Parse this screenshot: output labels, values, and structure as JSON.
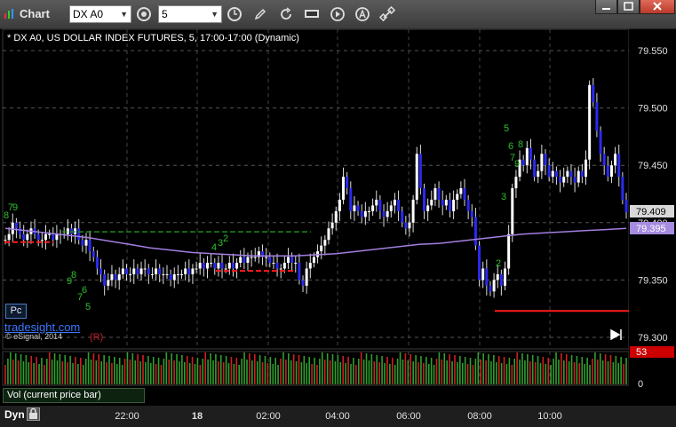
{
  "window": {
    "title": "Chart"
  },
  "toolbar": {
    "symbol": "DX A0",
    "interval": "5",
    "tool_icons": [
      "clock-icon",
      "pencil-icon",
      "refresh-icon",
      "template-icon",
      "play-icon",
      "text-icon",
      "link-icon"
    ]
  },
  "window_controls": [
    "minimize",
    "maximize",
    "close"
  ],
  "chart": {
    "legend": "* DX A0, US DOLLAR INDEX FUTURES, 5, 17:00-17:00 (Dynamic)",
    "price_axis_ticks": [
      "79.550",
      "79.500",
      "79.450",
      "79.400",
      "79.350",
      "79.300"
    ],
    "last_price_tag": "79.409",
    "ma_price_tag": "79.395",
    "time_labels": [
      "22:00",
      "18",
      "02:00",
      "04:00",
      "06:00",
      "08:00",
      "10:00"
    ],
    "pc_label": "Pc",
    "watermark": "tradesight.com",
    "copyright": "© eSignal, 2014",
    "r_marker": "(R)",
    "setup_numbers": [
      "8",
      "7",
      "9",
      "5",
      "6",
      "7",
      "8",
      "9",
      "3",
      "2",
      "9",
      "8",
      "7",
      "6",
      "5",
      "4",
      "3",
      "2"
    ]
  },
  "volume_pane": {
    "title": "Vol (current price bar)",
    "tag": "53",
    "zero_label": "0"
  },
  "status": {
    "mode": "Dyn"
  },
  "colors": {
    "up_candle": "#ffffff",
    "down_candle": "#2a2af0",
    "moving_average": "#a27fe0",
    "setup_numbers": "#2fbf2f",
    "resistance_green": "#1b8a1b",
    "support_red": "#ff1a1a",
    "last_tag_bg": "#d8d8d8",
    "ma_tag_bg": "#a68ce0",
    "vol_up": "#2f9f2f",
    "vol_down": "#d02020",
    "vol_tag_bg": "#cc0000"
  },
  "chart_data": {
    "type": "candlestick",
    "ylim": [
      79.3,
      79.57
    ],
    "y_ticks": [
      79.55,
      79.5,
      79.45,
      79.4,
      79.35,
      79.3
    ],
    "x_labels": [
      "22:00",
      "18",
      "02:00",
      "04:00",
      "06:00",
      "08:00",
      "10:00"
    ],
    "last_price": 79.409,
    "moving_average_last": 79.395,
    "closes": [
      79.385,
      79.39,
      79.4,
      79.395,
      79.39,
      79.385,
      79.39,
      79.395,
      79.39,
      79.385,
      79.385,
      79.39,
      79.39,
      79.385,
      79.39,
      79.39,
      79.39,
      79.395,
      79.39,
      79.395,
      79.385,
      79.38,
      79.385,
      79.375,
      79.37,
      79.36,
      79.355,
      79.345,
      79.35,
      79.355,
      79.35,
      79.355,
      79.36,
      79.355,
      79.355,
      79.36,
      79.355,
      79.36,
      79.36,
      79.355,
      79.355,
      79.36,
      79.355,
      79.355,
      79.355,
      79.35,
      79.355,
      79.355,
      79.355,
      79.36,
      79.355,
      79.36,
      79.36,
      79.365,
      79.36,
      79.365,
      79.365,
      79.36,
      79.365,
      79.36,
      79.36,
      79.365,
      79.36,
      79.365,
      79.37,
      79.365,
      79.37,
      79.37,
      79.37,
      79.375,
      79.37,
      79.37,
      79.365,
      79.365,
      79.36,
      79.36,
      79.365,
      79.37,
      79.365,
      79.365,
      79.35,
      79.345,
      79.36,
      79.365,
      79.37,
      79.375,
      79.38,
      79.385,
      79.395,
      79.4,
      79.41,
      79.42,
      79.44,
      79.43,
      79.41,
      79.415,
      79.41,
      79.405,
      79.41,
      79.41,
      79.415,
      79.42,
      79.41,
      79.405,
      79.41,
      79.415,
      79.42,
      79.41,
      79.4,
      79.395,
      79.4,
      79.42,
      79.46,
      79.43,
      79.41,
      79.415,
      79.42,
      79.43,
      79.42,
      79.415,
      79.42,
      79.41,
      79.42,
      79.425,
      79.43,
      79.42,
      79.41,
      79.405,
      79.38,
      79.35,
      79.36,
      79.345,
      79.34,
      79.35,
      79.355,
      79.345,
      79.36,
      79.39,
      79.43,
      79.44,
      79.455,
      79.45,
      79.465,
      79.455,
      79.44,
      79.445,
      79.46,
      79.45,
      79.44,
      79.445,
      79.44,
      79.435,
      79.44,
      79.445,
      79.44,
      79.435,
      79.445,
      79.44,
      79.455,
      79.52,
      79.505,
      79.48,
      79.46,
      79.45,
      79.44,
      79.45,
      79.46,
      79.44,
      79.42,
      79.409
    ],
    "moving_average": [
      79.395,
      79.393,
      79.391,
      79.389,
      79.387,
      79.384,
      79.381,
      79.378,
      79.376,
      79.374,
      79.373,
      79.372,
      79.371,
      79.371,
      79.371,
      79.372,
      79.373,
      79.375,
      79.377,
      79.379,
      79.381,
      79.382,
      79.384,
      79.386,
      79.388,
      79.39,
      79.391,
      79.392,
      79.393,
      79.394,
      79.395
    ],
    "support_levels": [
      79.383,
      79.358,
      79.323
    ],
    "resistance_levels": [
      79.392
    ],
    "volume_last": 53
  }
}
